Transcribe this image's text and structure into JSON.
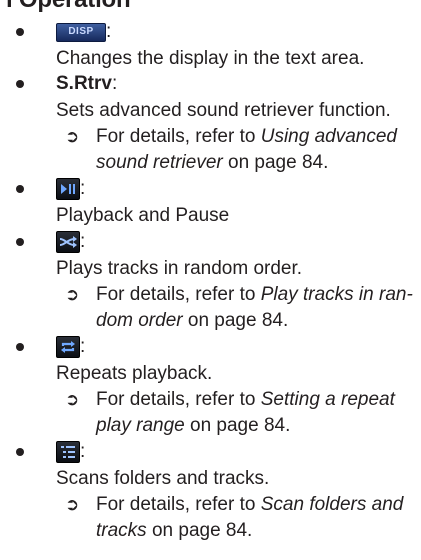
{
  "heading": "ı Operation",
  "items": [
    {
      "icon": "disp-button-icon",
      "icon_label": "DISP",
      "title_suffix": ":",
      "description": "Changes the display in the text area."
    },
    {
      "title": "S.Rtrv",
      "title_suffix": ":",
      "description": "Sets advanced sound retriever function.",
      "ref_line1_prefix": "For details, refer to ",
      "ref_line1_italic": "Using advanced",
      "ref_line2_italic": "sound retriever",
      "ref_line2_suffix": " on page 84."
    },
    {
      "icon": "play-pause-icon",
      "title_suffix": ":",
      "description": "Playback and Pause"
    },
    {
      "icon": "shuffle-icon",
      "title_suffix": ":",
      "description": "Plays tracks in random order.",
      "ref_line1_prefix": "For details, refer to ",
      "ref_line1_italic": "Play tracks in ran-",
      "ref_line2_italic": "dom order",
      "ref_line2_suffix": " on page 84."
    },
    {
      "icon": "repeat-icon",
      "title_suffix": ":",
      "description": "Repeats playback.",
      "ref_line1_prefix": "For details, refer to ",
      "ref_line1_italic": "Setting a repeat",
      "ref_line2_italic": "play range",
      "ref_line2_suffix": " on page 84."
    },
    {
      "icon": "scan-list-icon",
      "title_suffix": ":",
      "description": "Scans folders and tracks.",
      "ref_line1_prefix": "For details, refer to ",
      "ref_line1_italic": "Scan folders and",
      "ref_line2_italic": "tracks",
      "ref_line2_suffix": " on page 84."
    }
  ],
  "ref_arrow": "➲",
  "colors": {
    "text": "#231f20",
    "disp_icon": "#2a4a8c",
    "icon_dark": "#111111",
    "icon_accent": "#6fa8ff"
  }
}
